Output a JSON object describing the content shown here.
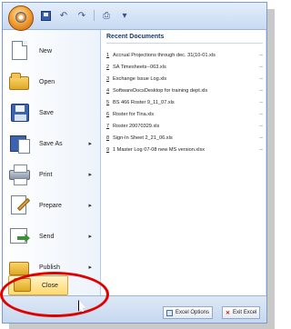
{
  "office_button": {
    "icon": "office-orb-icon"
  },
  "quick_access": {
    "items": [
      {
        "name": "save-icon"
      },
      {
        "name": "undo-icon",
        "glyph": "↶"
      },
      {
        "name": "redo-icon",
        "glyph": "↷"
      },
      {
        "name": "print-preview-icon",
        "glyph": "⎙"
      },
      {
        "name": "customize-icon",
        "glyph": "▾"
      }
    ]
  },
  "menu": {
    "items": [
      {
        "key": "new",
        "label": "New",
        "has_submenu": false,
        "icon": "new-document-icon"
      },
      {
        "key": "open",
        "label": "Open",
        "has_submenu": false,
        "icon": "open-folder-icon"
      },
      {
        "key": "save",
        "label": "Save",
        "has_submenu": false,
        "icon": "save-floppy-icon"
      },
      {
        "key": "save_as",
        "label": "Save As",
        "has_submenu": true,
        "icon": "save-as-icon"
      },
      {
        "key": "print",
        "label": "Print",
        "has_submenu": true,
        "icon": "printer-icon"
      },
      {
        "key": "prepare",
        "label": "Prepare",
        "has_submenu": true,
        "icon": "prepare-icon"
      },
      {
        "key": "send",
        "label": "Send",
        "has_submenu": true,
        "icon": "send-icon"
      },
      {
        "key": "publish",
        "label": "Publish",
        "has_submenu": true,
        "icon": "publish-icon"
      },
      {
        "key": "close",
        "label": "Close",
        "has_submenu": false,
        "icon": "close-folder-icon",
        "highlighted": true
      }
    ],
    "arrow_glyph": "▸"
  },
  "recent": {
    "title": "Recent Documents",
    "pin_glyph": "⊸",
    "documents": [
      {
        "num": "1",
        "name": "Accrual Projections through dec. 31(10-01.xls"
      },
      {
        "num": "2",
        "name": "SA Timesheets--063.xls"
      },
      {
        "num": "3",
        "name": "Exchange Issue Log.xls"
      },
      {
        "num": "4",
        "name": "SoftwareDocsDesktop for training dept.xls"
      },
      {
        "num": "5",
        "name": "BS 466 Roster 9_11_07.xls"
      },
      {
        "num": "6",
        "name": "Roster for Tina.xls"
      },
      {
        "num": "7",
        "name": "Roster 20070329.xls"
      },
      {
        "num": "8",
        "name": "Sign-In Sheet 2_21_06.xls"
      },
      {
        "num": "9",
        "name": "1 Master Log 07-08 new MS version.xlsx"
      }
    ]
  },
  "footer": {
    "options_label": "Excel Options",
    "exit_label": "Exit Excel"
  },
  "annotation": {
    "color": "#e10000"
  }
}
